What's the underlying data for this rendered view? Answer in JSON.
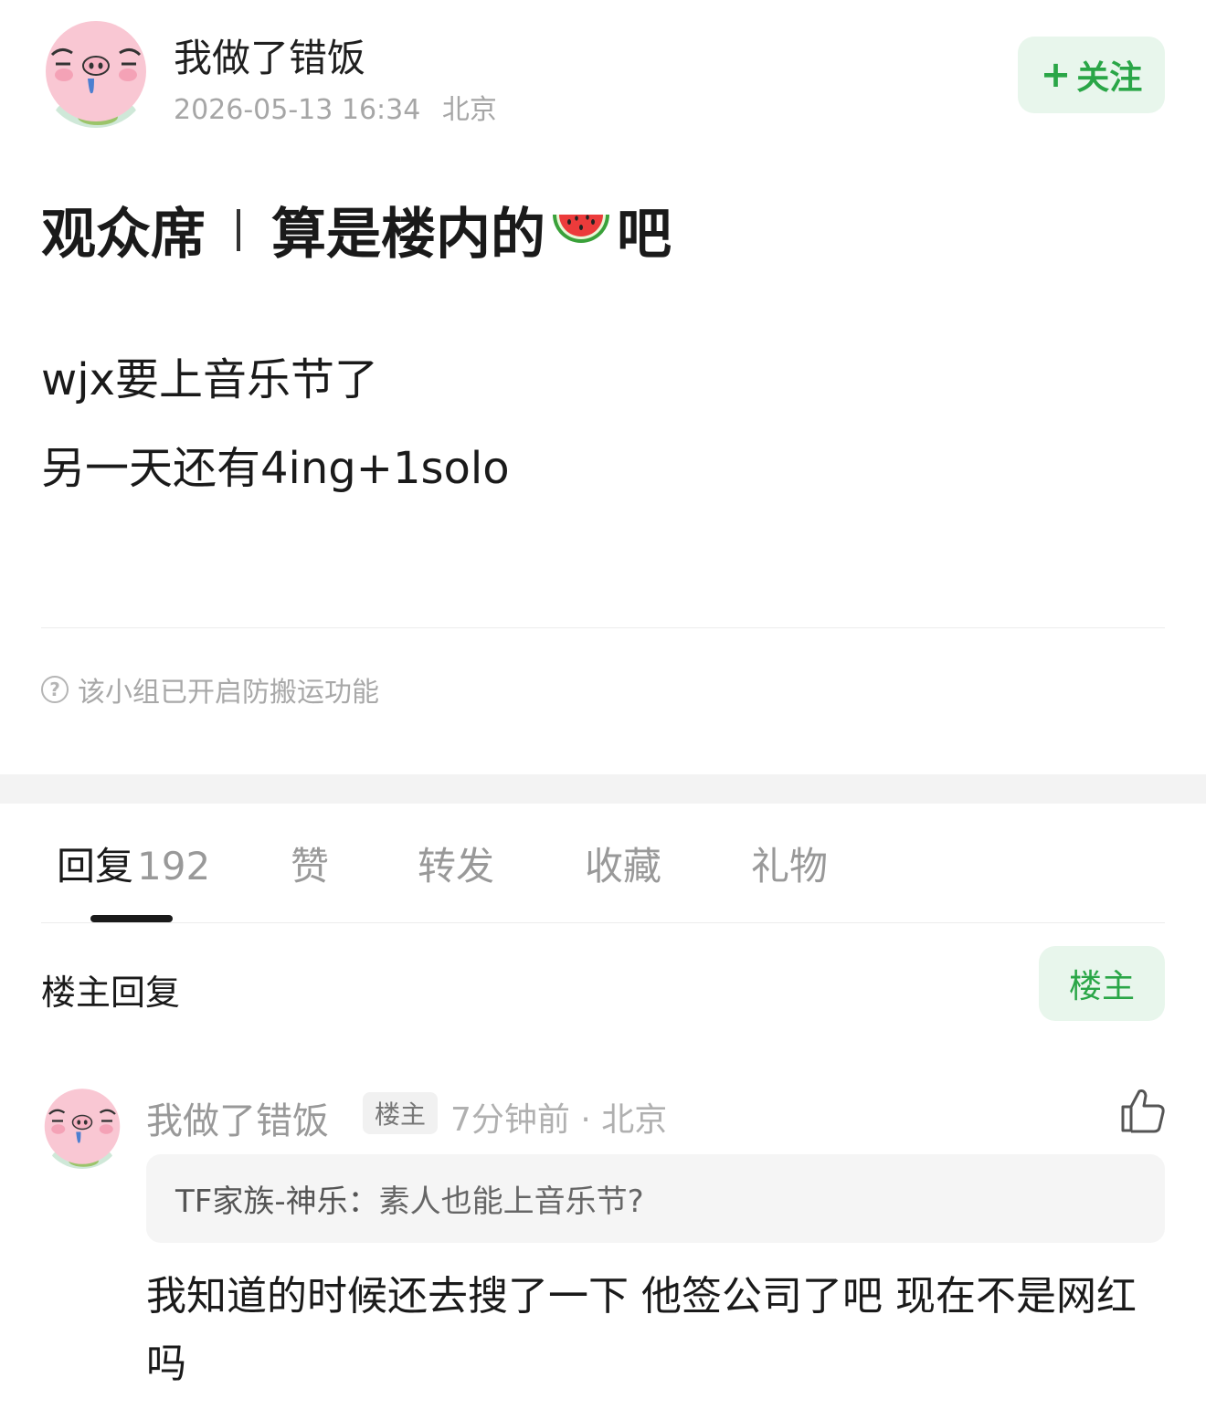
{
  "post": {
    "author": "我做了错饭",
    "timestamp": "2026-05-13 16:34",
    "location": "北京",
    "follow_label": "关注",
    "title_part1": "观众席",
    "title_part2": "算是楼内的",
    "title_emoji": "watermelon",
    "title_part3": "吧",
    "body_lines": [
      "wjx要上音乐节了",
      "另一天还有4ing+1solo"
    ],
    "notice": "该小组已开启防搬运功能"
  },
  "tabs": [
    {
      "label": "回复",
      "count": "192",
      "active": true
    },
    {
      "label": "赞"
    },
    {
      "label": "转发"
    },
    {
      "label": "收藏"
    },
    {
      "label": "礼物"
    }
  ],
  "filter": {
    "label": "楼主回复",
    "op_button": "楼主"
  },
  "reply": {
    "author": "我做了错饭",
    "badge": "楼主",
    "time_location": "7分钟前 · 北京",
    "quote_author": "TF家族-神乐：",
    "quote_text": "素人也能上音乐节?",
    "text": "我知道的时候还去搜了一下 他签公司了吧 现在不是网红吗"
  },
  "colors": {
    "accent_green": "#2aa647",
    "accent_green_bg": "#e8f6ec",
    "muted_text": "#a6a6a6"
  },
  "icons": [
    "pig-avatar",
    "plus-icon",
    "watermelon-icon",
    "question-circle-icon",
    "thumbs-up-icon"
  ]
}
